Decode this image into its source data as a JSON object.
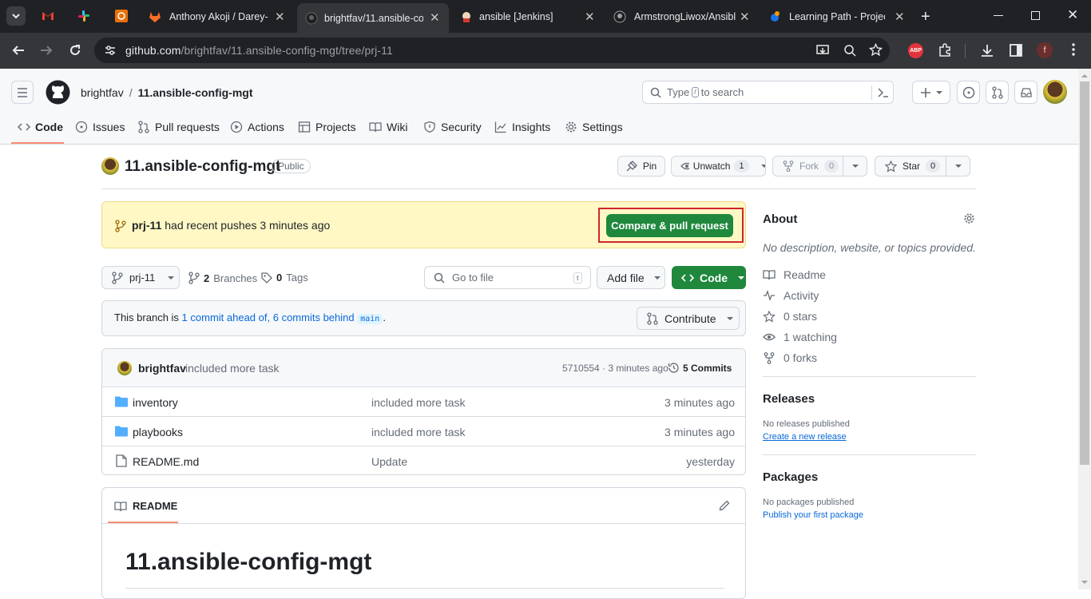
{
  "browser": {
    "tabs": [
      {
        "title": "",
        "icon": "gmail-icon"
      },
      {
        "title": "",
        "icon": "slack-icon"
      },
      {
        "title": "",
        "icon": "app-icon"
      },
      {
        "title": "Anthony Akoji / Darey-",
        "icon": "gitlab-icon"
      },
      {
        "title": "brightfav/11.ansible-co",
        "icon": "github-icon"
      },
      {
        "title": "ansible [Jenkins]",
        "icon": "jenkins-icon"
      },
      {
        "title": "ArmstrongLiwox/Ansibl",
        "icon": "github-icon"
      },
      {
        "title": "Learning Path - Project",
        "icon": "darey-icon"
      }
    ],
    "url_host": "github.com",
    "url_path": "/brightfav/11.ansible-config-mgt/tree/prj-11",
    "profile_initial": "f",
    "ext_label": "ABP"
  },
  "header": {
    "owner": "brightfav",
    "sep": "/",
    "repo": "11.ansible-config-mgt",
    "search_prefix": "Type",
    "search_key": "/",
    "search_suffix": "to search"
  },
  "nav": {
    "code": "Code",
    "issues": "Issues",
    "pulls": "Pull requests",
    "actions": "Actions",
    "projects": "Projects",
    "wiki": "Wiki",
    "security": "Security",
    "insights": "Insights",
    "settings": "Settings"
  },
  "repo": {
    "name": "11.ansible-config-mgt",
    "visibility": "Public",
    "pin": "Pin",
    "unwatch": "Unwatch",
    "watch_count": "1",
    "fork": "Fork",
    "fork_count": "0",
    "star": "Star",
    "star_count": "0"
  },
  "banner": {
    "branch": "prj-11",
    "text": "had recent pushes 3 minutes ago",
    "button": "Compare & pull request"
  },
  "toolbar": {
    "branch": "prj-11",
    "branches_count": "2",
    "branches_label": "Branches",
    "tags_count": "0",
    "tags_label": "Tags",
    "goto_placeholder": "Go to file",
    "goto_key": "t",
    "add_file": "Add file",
    "code": "Code"
  },
  "branch_info": {
    "prefix": "This branch is",
    "ahead": "1 commit ahead of,",
    "behind": "6 commits behind",
    "base": "main",
    "suffix": ".",
    "contribute": "Contribute"
  },
  "commit": {
    "author": "brightfav",
    "message": "included more task",
    "sha_time": "5710554 · 3 minutes ago",
    "commits": "5 Commits"
  },
  "files": [
    {
      "name": "inventory",
      "type": "folder",
      "message": "included more task",
      "time": "3 minutes ago"
    },
    {
      "name": "playbooks",
      "type": "folder",
      "message": "included more task",
      "time": "3 minutes ago"
    },
    {
      "name": "README.md",
      "type": "file",
      "message": "Update",
      "time": "yesterday"
    }
  ],
  "readme": {
    "tab": "README",
    "heading": "11.ansible-config-mgt"
  },
  "about": {
    "title": "About",
    "description": "No description, website, or topics provided.",
    "readme": "Readme",
    "activity": "Activity",
    "stars": "0 stars",
    "watching": "1 watching",
    "forks": "0 forks"
  },
  "releases": {
    "title": "Releases",
    "none": "No releases published",
    "create": "Create a new release"
  },
  "packages": {
    "title": "Packages",
    "none": "No packages published",
    "publish": "Publish your first package"
  },
  "colors": {
    "primary_green": "#1f883d",
    "link_blue": "#0969da",
    "banner_bg": "#fff8c5",
    "highlight_red": "#d1242f"
  }
}
